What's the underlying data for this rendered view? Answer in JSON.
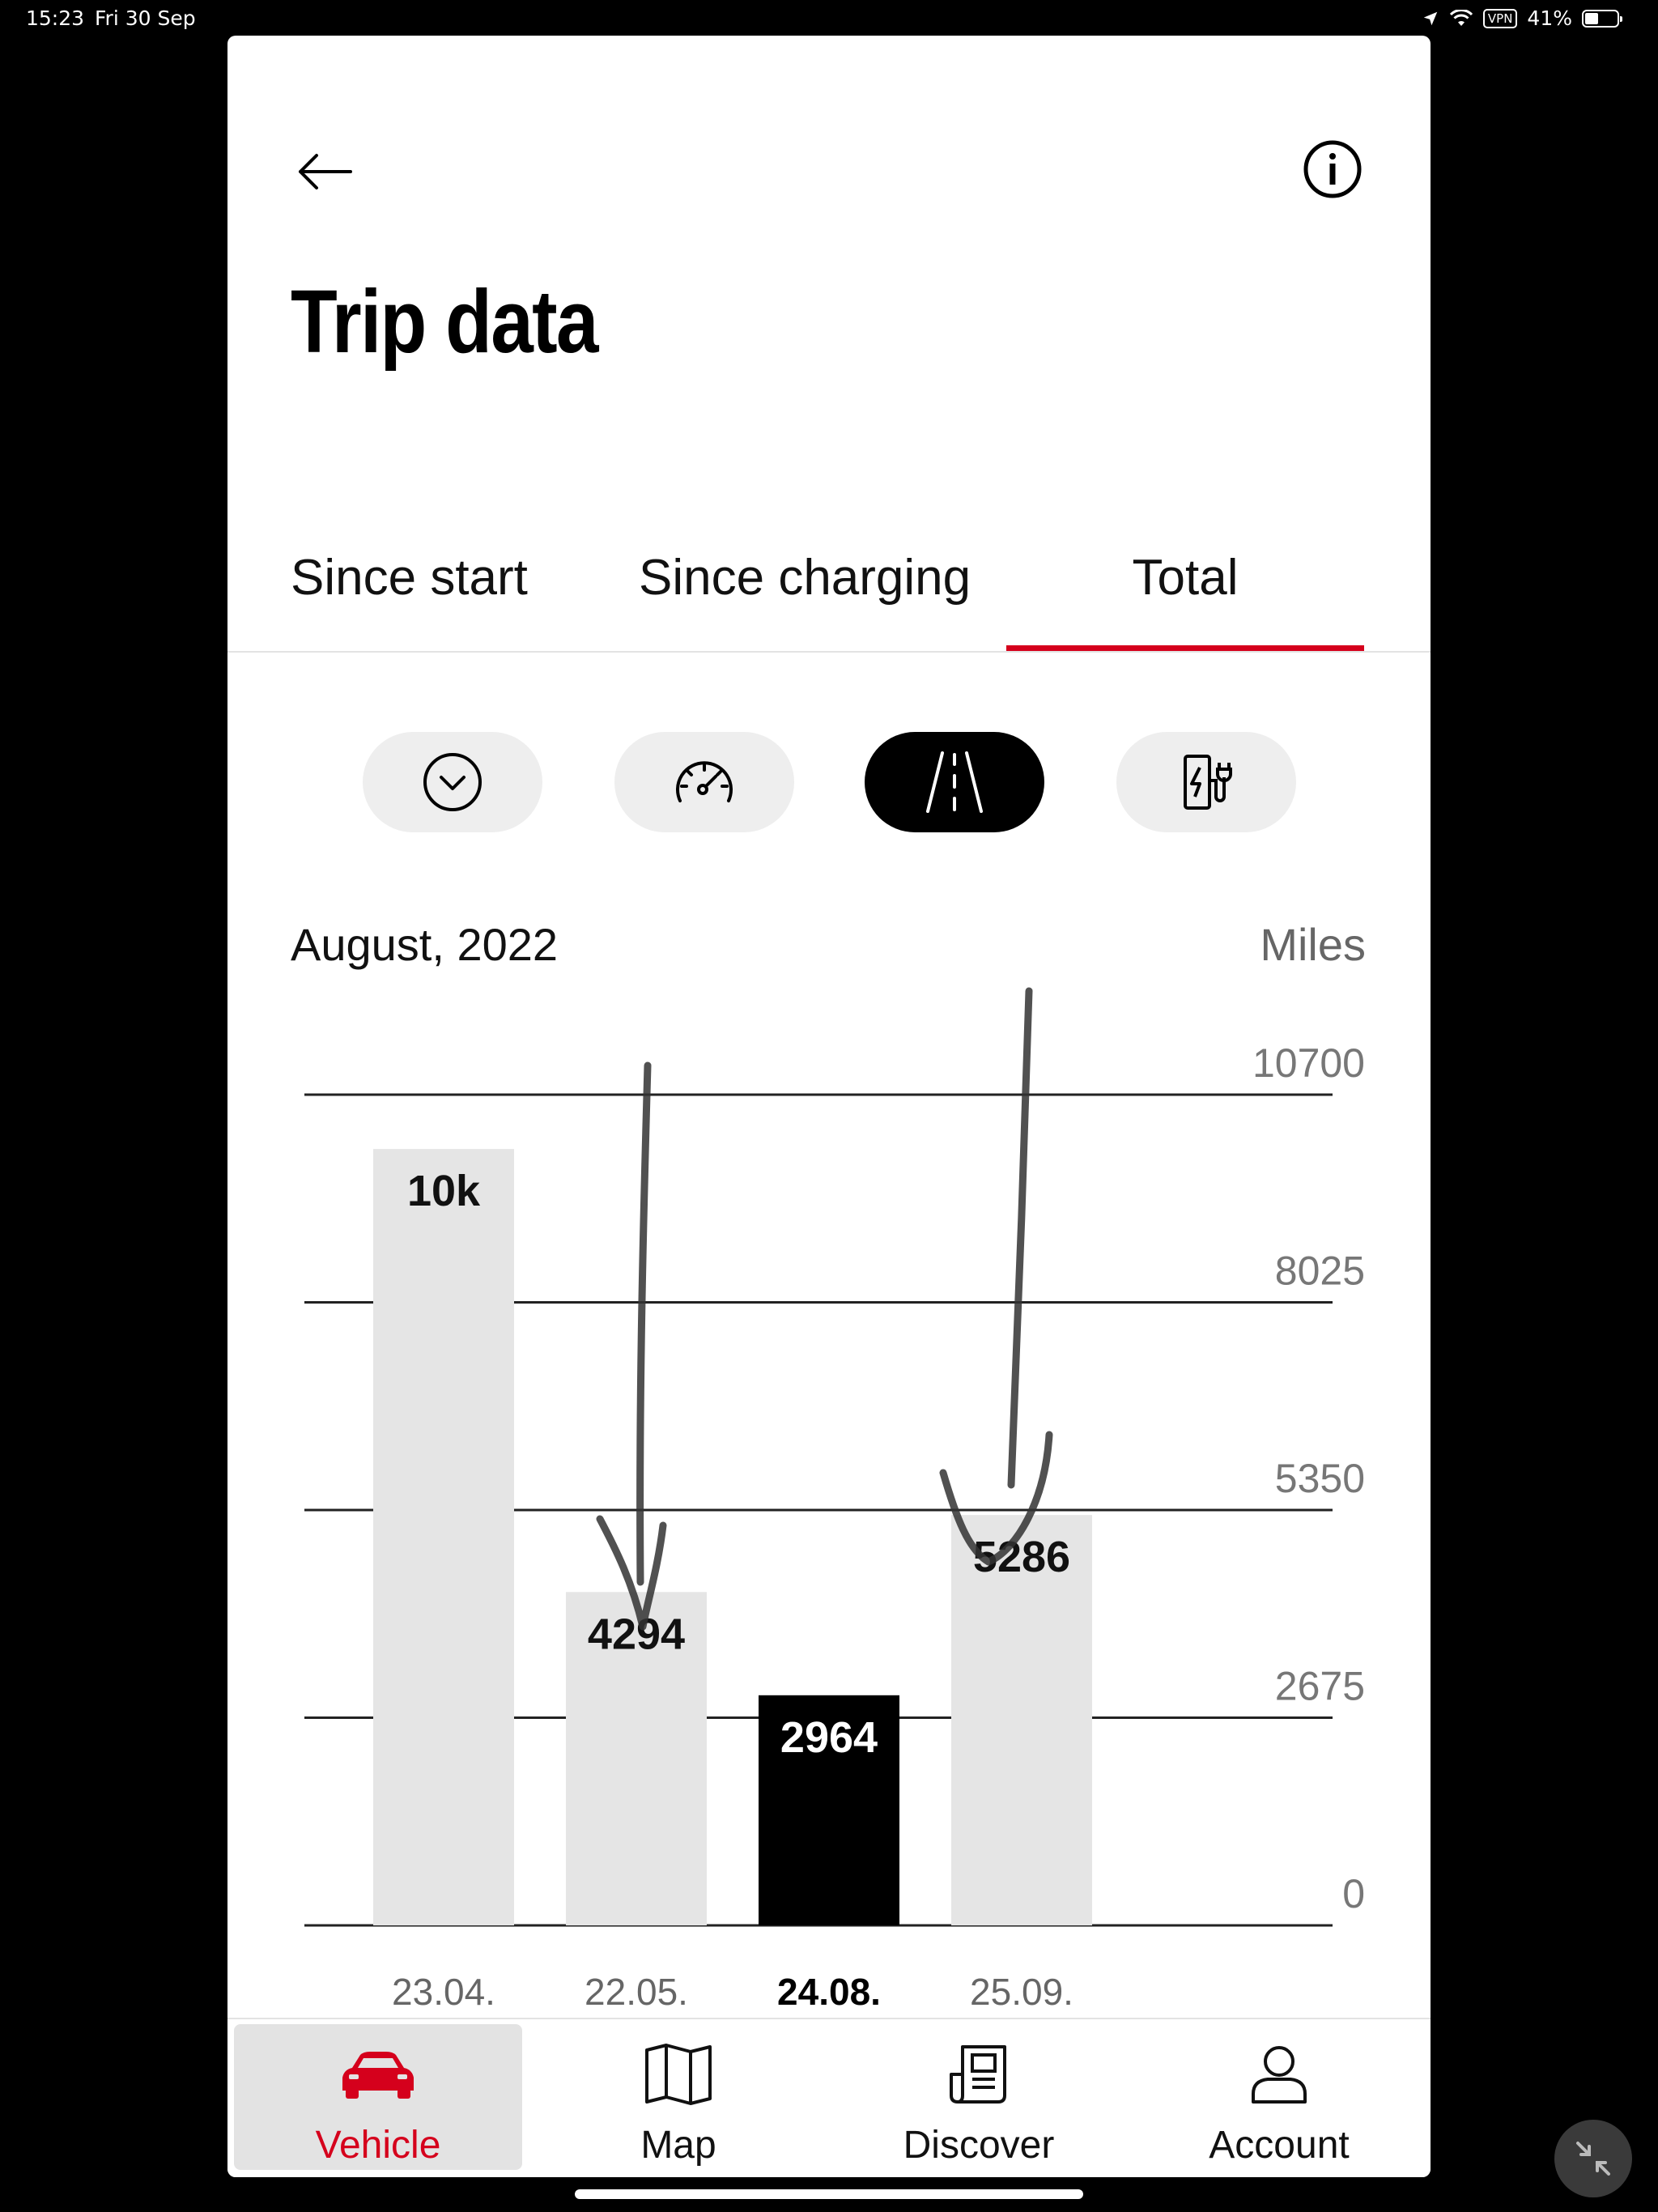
{
  "status_bar": {
    "time": "15:23",
    "date": "Fri 30 Sep",
    "vpn": "VPN",
    "battery": "41%",
    "battery_level": 0.41
  },
  "header": {
    "title": "Trip data",
    "back_icon": "arrow-left-icon",
    "info_icon": "info-icon"
  },
  "tabs": [
    {
      "label": "Since start",
      "active": false
    },
    {
      "label": "Since charging",
      "active": false
    },
    {
      "label": "Total",
      "active": true
    }
  ],
  "metric_buttons": [
    {
      "icon": "chevron-down-circle-icon",
      "active": false
    },
    {
      "icon": "speedometer-icon",
      "active": false
    },
    {
      "icon": "road-icon",
      "active": true
    },
    {
      "icon": "charging-station-icon",
      "active": false
    }
  ],
  "chart_header": {
    "period": "August, 2022",
    "unit": "Miles"
  },
  "chart_data": {
    "type": "bar",
    "categories": [
      "23.04.",
      "22.05.",
      "24.08.",
      "25.09."
    ],
    "values": [
      10000,
      4294,
      2964,
      5286
    ],
    "data_labels": [
      "10k",
      "4294",
      "2964",
      "5286"
    ],
    "highlighted_index": 2,
    "ylim": [
      0,
      10700
    ],
    "y_ticks": [
      0,
      2675,
      5350,
      8025,
      10700
    ],
    "y_tick_labels": [
      "0",
      "2675",
      "5350",
      "8025",
      "10700"
    ],
    "grid": true,
    "bar_color": "#e5e5e5",
    "highlight_color": "#000000"
  },
  "bottom_nav": [
    {
      "label": "Vehicle",
      "icon": "car-icon",
      "active": true
    },
    {
      "label": "Map",
      "icon": "map-icon",
      "active": false
    },
    {
      "label": "Discover",
      "icon": "news-icon",
      "active": false
    },
    {
      "label": "Account",
      "icon": "user-icon",
      "active": false
    }
  ],
  "colors": {
    "accent": "#d5001c",
    "background": "#ffffff",
    "frame": "#000000"
  }
}
